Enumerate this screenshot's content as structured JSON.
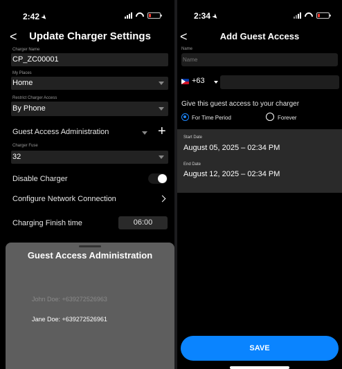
{
  "left": {
    "status": {
      "time": "2:42"
    },
    "title": "Update Charger Settings",
    "charger_name": {
      "label": "Charger Name",
      "value": "CP_ZC00001"
    },
    "my_places": {
      "label": "My Places",
      "value": "Home"
    },
    "restrict_access": {
      "label": "Restrict Charger Access",
      "value": "By Phone"
    },
    "guest_access_admin": "Guest Access Administration",
    "charger_fuse": {
      "label": "Charger Fuse",
      "value": "32"
    },
    "disable_charger": "Disable Charger",
    "configure_network": "Configure Network Connection",
    "charging_finish": {
      "label": "Charging Finish time",
      "value": "06:00"
    },
    "sheet": {
      "title": "Guest Access Administration",
      "guests": [
        "John Doe: +639272526963",
        "Jane Doe: +639272526961"
      ]
    }
  },
  "right": {
    "status": {
      "time": "2:34"
    },
    "title": "Add Guest Access",
    "name_label": "Name",
    "name_placeholder": "Name",
    "country_code": "+63",
    "prompt": "Give this guest access to your charger",
    "options": {
      "time_period": "For Time Period",
      "forever": "Forever"
    },
    "start": {
      "label": "Start Date",
      "value": "August 05, 2025 – 02:34 PM"
    },
    "end": {
      "label": "End Date",
      "value": "August 12, 2025 – 02:34 PM"
    },
    "save_label": "SAVE"
  },
  "colors": {
    "accent": "#0a84ff",
    "background": "#000000",
    "sheet": "#5e5e5e"
  }
}
